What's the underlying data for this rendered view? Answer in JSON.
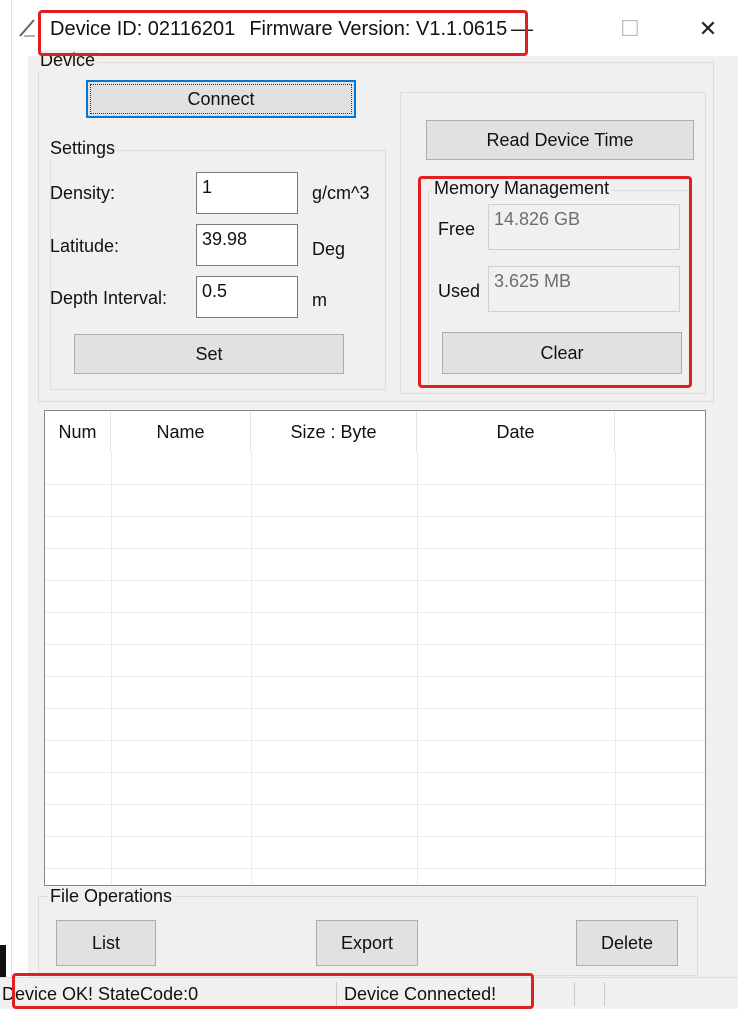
{
  "window": {
    "title_device": "Device ID: 02116201",
    "title_firmware": "Firmware Version: V1.1.0615",
    "minimize_glyph": "—",
    "maximize_glyph": "☐",
    "close_glyph": "✕"
  },
  "device_group": {
    "label": "Device",
    "connect_label": "Connect"
  },
  "settings": {
    "label": "Settings",
    "density_label": "Density:",
    "density_value": "1",
    "density_unit": "g/cm^3",
    "latitude_label": "Latitude:",
    "latitude_value": "39.98",
    "latitude_unit": "Deg",
    "depth_label": "Depth Interval:",
    "depth_value": "0.5",
    "depth_unit": "m",
    "set_label": "Set"
  },
  "right_panel": {
    "read_time_label": "Read  Device Time"
  },
  "memory": {
    "label": "Memory Management",
    "free_label": "Free",
    "free_value": "14.826 GB",
    "used_label": "Used",
    "used_value": "3.625 MB",
    "clear_label": "Clear"
  },
  "file_list": {
    "columns": [
      "Num",
      "Name",
      "Size : Byte",
      "Date"
    ],
    "rows": []
  },
  "file_ops": {
    "label": "File Operations",
    "list_label": "List",
    "export_label": "Export",
    "delete_label": "Delete"
  },
  "status": {
    "state": "Device OK! StateCode:0",
    "connection": "Device Connected!"
  },
  "colors": {
    "highlight": "#e02020",
    "focus": "#0078d7"
  }
}
